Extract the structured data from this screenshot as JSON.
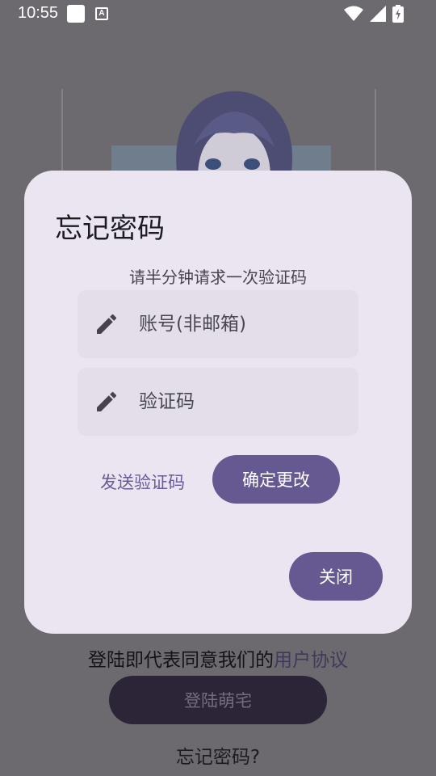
{
  "status_bar": {
    "time": "10:55",
    "notification_a": "A",
    "icons": [
      "wifi-icon",
      "signal-icon",
      "battery-charging-icon"
    ],
    "icon_color": "#ffffff"
  },
  "background": {
    "agreement_prefix": "登陆即代表同意我们的",
    "agreement_link": "用户协议",
    "login_button": "登陆萌宅",
    "forgot_link": "忘记密码?"
  },
  "dialog": {
    "title": "忘记密码",
    "hint": "请半分钟请求一次验证码",
    "account_field": {
      "placeholder": "账号(非邮箱)",
      "value": "",
      "icon": "pencil-icon"
    },
    "code_field": {
      "placeholder": "验证码",
      "value": "",
      "icon": "pencil-icon"
    },
    "send_code": "发送验证码",
    "confirm": "确定更改",
    "close": "关闭"
  },
  "colors": {
    "dialog_bg": "#ebe5f2",
    "field_bg": "#e3dee9",
    "accent": "#665891",
    "scrim": "#6c6a6e"
  }
}
